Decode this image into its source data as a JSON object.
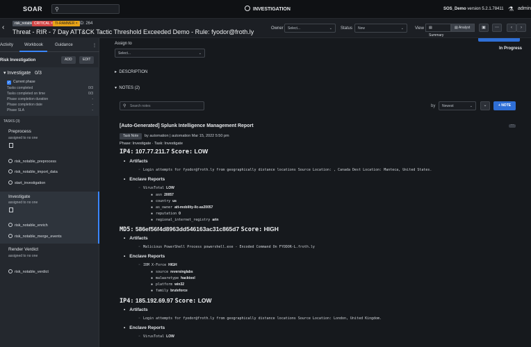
{
  "topbar": {
    "logo": "SOAR",
    "section": "INVESTIGATION",
    "env_name": "SOS_Demo",
    "version": "version 5.2.1.78411",
    "user": "admin"
  },
  "case": {
    "tags": [
      "risk_notable",
      "CRITICAL ×",
      "TI-RAMMER ×"
    ],
    "id_label": "ID: 264",
    "title": "Threat - RIR - 7 Day ATT&CK Tactic Threshold Exceeded Demo - Rule: fyodor@froth.ly",
    "owner_label": "Owner",
    "owner_placeholder": "Select...",
    "status_label": "Status",
    "status_value": "New",
    "view_label": "View",
    "view_summary": "Summary",
    "view_analyst": "Analyst"
  },
  "sidebar": {
    "tabs": [
      "Activity",
      "Workbook",
      "Guidance"
    ],
    "workbook_name": "Risk Investigation",
    "add_label": "ADD",
    "edit_label": "EDIT",
    "phase": {
      "name": "Investigate",
      "count": "0/3",
      "current": "Current phase",
      "rows": [
        {
          "k": "Tasks completed",
          "v": "0/3"
        },
        {
          "k": "Tasks completed on time",
          "v": "0/3"
        },
        {
          "k": "Phase completion duration",
          "v": "-"
        },
        {
          "k": "Phase completion date",
          "v": "-"
        },
        {
          "k": "Phase SLA",
          "v": "-"
        }
      ]
    },
    "tasks_header": "TASKS (3)",
    "tasks": [
      {
        "title": "Preprocess",
        "assigned": "assigned to no one",
        "actions": [
          "risk_notable_preprocess",
          "risk_notable_import_data",
          "start_investigation"
        ]
      },
      {
        "title": "Investigate",
        "assigned": "assigned to no one",
        "actions": [
          "risk_notable_enrich",
          "risk_notable_merge_events"
        ]
      },
      {
        "title": "Render Verdict",
        "assigned": "assigned to no one",
        "actions": [
          "risk_notable_verdict"
        ]
      }
    ]
  },
  "main": {
    "assign_label": "Assign to",
    "assign_placeholder": "Select...",
    "status_text": "In Progress",
    "description": "DESCRIPTION",
    "notes": "NOTES (2)",
    "search_placeholder": "Search notes",
    "sort_by": "by",
    "sort_value": "Newest",
    "add_note": "+ NOTE",
    "note": {
      "title": "[Auto-Generated] Splunk Intelligence Management Report",
      "badge": "Task Note",
      "author": "by automation | automation  Mar 15, 2022 5:50 pm",
      "phase_line": "Phase: Investigate  ·  Task: Investigate",
      "iocs": [
        {
          "type": "IP4:",
          "value": "107.77.211.7",
          "score_label": "Score:",
          "score": "LOW",
          "artifacts_label": "Artifacts",
          "artifact": "Login attempts for fyodor@froth.ly from geographically distance locations Source Location: , Canada Dest Location: Manteca, United States.",
          "enclave_label": "Enclave Reports",
          "source": "VirusTotal",
          "source_score": "LOW",
          "attrs": [
            {
              "k": "asn",
              "v": "20057"
            },
            {
              "k": "country",
              "v": "us"
            },
            {
              "k": "as_owner",
              "v": "att-mobility-llc-as20057"
            },
            {
              "k": "reputation",
              "v": "0"
            },
            {
              "k": "regional_internet_registry",
              "v": "arin"
            }
          ]
        },
        {
          "type": "MD5:",
          "value": "586ef56f4d8963dd546163ac31c865d7",
          "score_label": "Score:",
          "score": "HIGH",
          "artifacts_label": "Artifacts",
          "artifact": "Malicious PowerShell Process powershell.exe - Encoded Command On FYODOR-L.froth.ly",
          "enclave_label": "Enclave Reports",
          "source": "IBM X-Force",
          "source_score": "HIGH",
          "attrs": [
            {
              "k": "source",
              "v": "reversinglabs"
            },
            {
              "k": "malwaretype",
              "v": "hacktool"
            },
            {
              "k": "platform",
              "v": "win32"
            },
            {
              "k": "family",
              "v": "bruteforce"
            }
          ]
        },
        {
          "type": "IP4:",
          "value": "185.192.69.97",
          "score_label": "Score:",
          "score": "LOW",
          "artifacts_label": "Artifacts",
          "artifact": "Login attempts for fyodor@froth.ly from geographically distance locations Source Location: London, United Kingdom.",
          "enclave_label": "Enclave Reports",
          "source": "VirusTotal",
          "source_score": "LOW"
        }
      ]
    }
  }
}
